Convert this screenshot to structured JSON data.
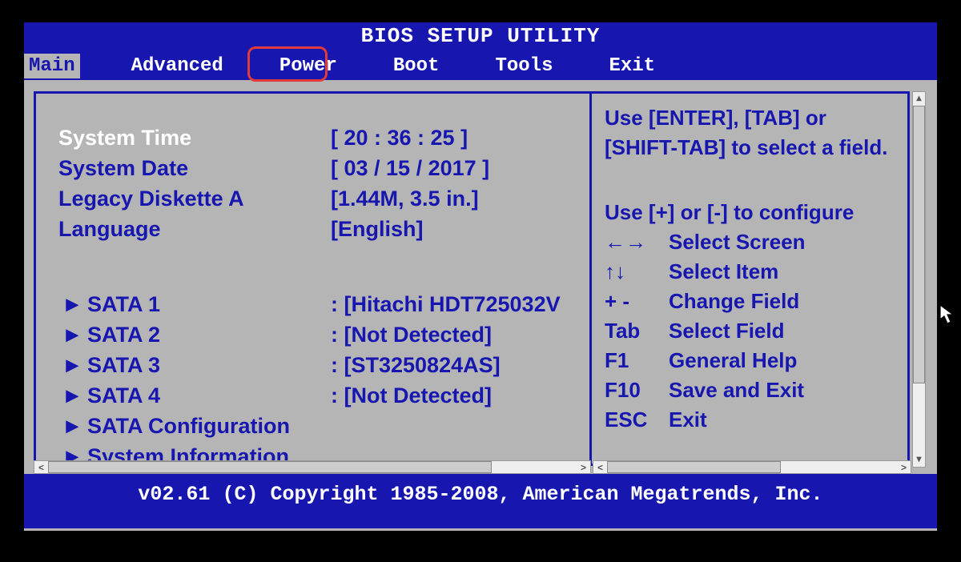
{
  "title": "BIOS SETUP UTILITY",
  "menu": {
    "items": [
      "Main",
      "Advanced",
      "Power",
      "Boot",
      "Tools",
      "Exit"
    ],
    "active_index": 0,
    "highlighted_index": 2
  },
  "main_panel": {
    "rows": [
      {
        "label": "System Time",
        "value": "[ 20 : 36 : 25 ]",
        "selected": true
      },
      {
        "label": "System Date",
        "value": "[ 03 / 15 / 2017 ]",
        "selected": false
      },
      {
        "label": "Legacy Diskette A",
        "value": "[1.44M, 3.5 in.]",
        "selected": false
      },
      {
        "label": "Language",
        "value": "[English]",
        "selected": false
      }
    ],
    "submenus": [
      {
        "marker": "►",
        "label": "SATA 1",
        "value": ": [Hitachi HDT725032V"
      },
      {
        "marker": "►",
        "label": "SATA 2",
        "value": ": [Not Detected]"
      },
      {
        "marker": "►",
        "label": "SATA 3",
        "value": ": [ST3250824AS]"
      },
      {
        "marker": "►",
        "label": "SATA 4",
        "value": ": [Not Detected]"
      },
      {
        "marker": "►",
        "label": "SATA Configuration",
        "value": ""
      },
      {
        "marker": "►",
        "label": "System Information",
        "value": ""
      }
    ]
  },
  "help_panel": {
    "text1": "Use [ENTER], [TAB] or [SHIFT-TAB] to select a field.",
    "text2": "Use [+] or [-] to configure",
    "nav": [
      {
        "key": "←→",
        "desc": "Select Screen"
      },
      {
        "key": "↑↓",
        "desc": "Select Item"
      },
      {
        "key": "+ -",
        "desc": "Change Field"
      },
      {
        "key": "Tab",
        "desc": "Select Field"
      },
      {
        "key": "F1",
        "desc": "General Help"
      },
      {
        "key": "F10",
        "desc": "Save and Exit"
      },
      {
        "key": "ESC",
        "desc": "Exit"
      }
    ]
  },
  "footer": "v02.61 (C) Copyright 1985-2008, American Megatrends, Inc."
}
